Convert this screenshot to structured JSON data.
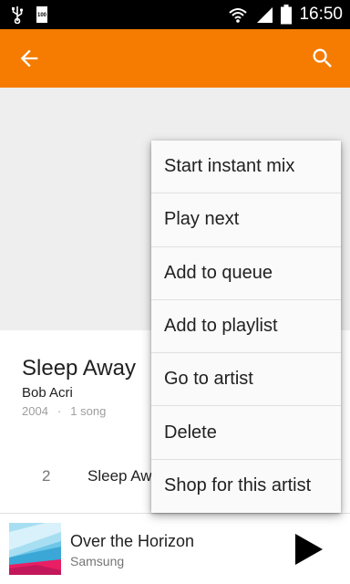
{
  "status_bar": {
    "battery_small_label": "100",
    "time": "16:50"
  },
  "app_bar": {
    "back_icon": "arrow-back-icon",
    "search_icon": "search-icon"
  },
  "album": {
    "title": "Sleep Away",
    "artist": "Bob Acri",
    "year": "2004",
    "separator": "·",
    "song_count": "1 song"
  },
  "tracks": [
    {
      "number": "2",
      "title": "Sleep Away"
    }
  ],
  "context_menu": {
    "items": [
      "Start instant mix",
      "Play next",
      "Add to queue",
      "Add to playlist",
      "Go to artist",
      "Delete",
      "Shop for this artist"
    ]
  },
  "now_playing": {
    "title": "Over the Horizon",
    "artist": "Samsung",
    "play_icon": "play-icon"
  },
  "colors": {
    "accent": "#f57c00",
    "status_bar": "#000000",
    "hero": "#eeeeee"
  }
}
